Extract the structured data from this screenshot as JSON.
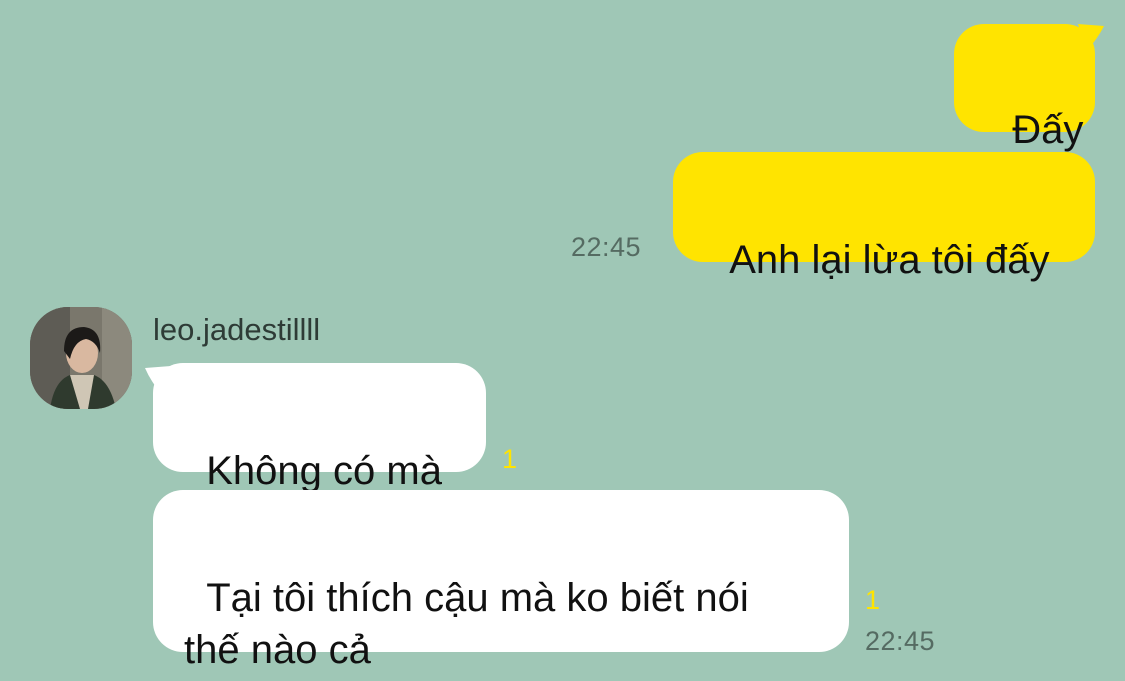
{
  "messages": {
    "out1": {
      "text": "Đấy"
    },
    "out2": {
      "text": "Anh lại lừa tôi đấy",
      "time": "22:45"
    },
    "in_sender": "leo.jadestillll",
    "in1": {
      "text": "Không có mà",
      "unread": "1"
    },
    "in2": {
      "text": "Tại tôi thích cậu mà ko biết nói\nthế nào cả",
      "unread": "1",
      "time": "22:45"
    }
  },
  "colors": {
    "background": "#9fc7b6",
    "outgoing_bubble": "#ffe400",
    "incoming_bubble": "#ffffff",
    "unread_count": "#ffe400"
  }
}
